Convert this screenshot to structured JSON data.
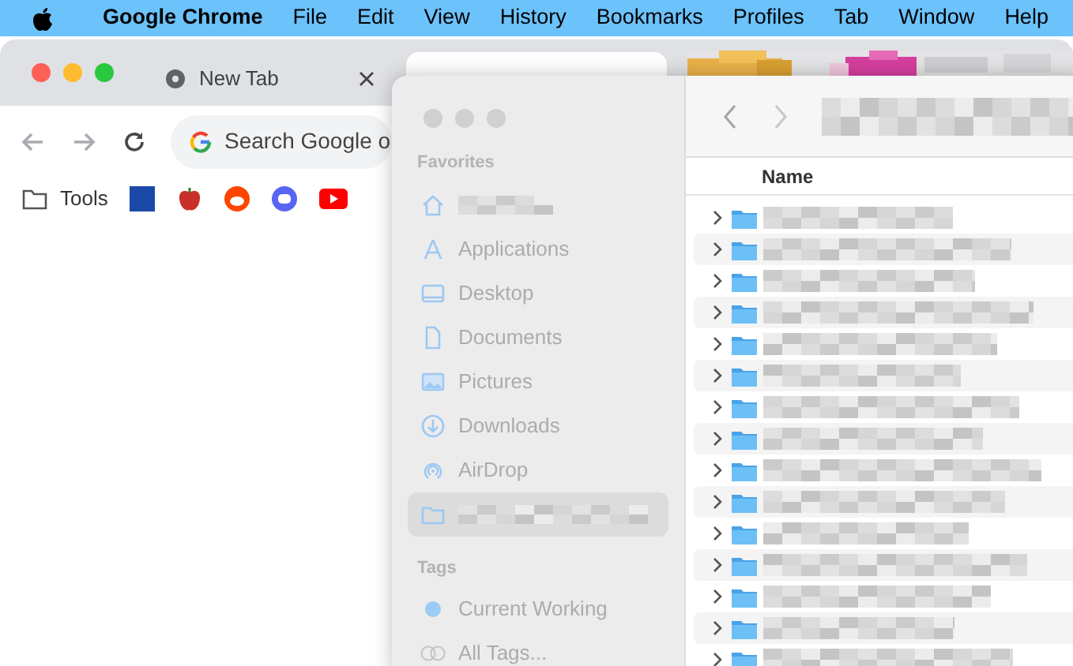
{
  "menu_bar": {
    "app": "Google Chrome",
    "items": [
      "File",
      "Edit",
      "View",
      "History",
      "Bookmarks",
      "Profiles",
      "Tab",
      "Window",
      "Help"
    ]
  },
  "browser": {
    "tabs": [
      {
        "label": "New Tab",
        "selected": false
      },
      {
        "selected": true
      }
    ],
    "omnibox": {
      "placeholder": "Search Google o"
    },
    "bookmarks": [
      {
        "label": "Tools"
      }
    ]
  },
  "finder": {
    "sidebar": {
      "sections": [
        {
          "title": "Favorites",
          "items": [
            {
              "selected": false
            },
            {
              "label": "Applications",
              "selected": false
            },
            {
              "label": "Desktop",
              "selected": false
            },
            {
              "label": "Documents",
              "selected": false
            },
            {
              "label": "Pictures",
              "selected": false
            },
            {
              "label": "Downloads",
              "selected": false
            },
            {
              "label": "AirDrop",
              "selected": false
            },
            {
              "selected": true
            }
          ]
        },
        {
          "title": "Tags",
          "items": [
            {
              "label": "Current Working",
              "kind": "tag",
              "color": "#9ccbf5"
            },
            {
              "label": "All Tags...",
              "kind": "all-tags"
            }
          ]
        }
      ]
    },
    "column_header": "Name",
    "rows": [
      {
        "expanded": false
      },
      {
        "expanded": false
      },
      {
        "expanded": false
      },
      {
        "expanded": false
      },
      {
        "expanded": false
      },
      {
        "expanded": false
      },
      {
        "expanded": false
      },
      {
        "expanded": false
      },
      {
        "expanded": false
      },
      {
        "expanded": false
      },
      {
        "expanded": false
      },
      {
        "expanded": false
      },
      {
        "expanded": false
      },
      {
        "expanded": false
      },
      {
        "expanded": false
      }
    ]
  }
}
